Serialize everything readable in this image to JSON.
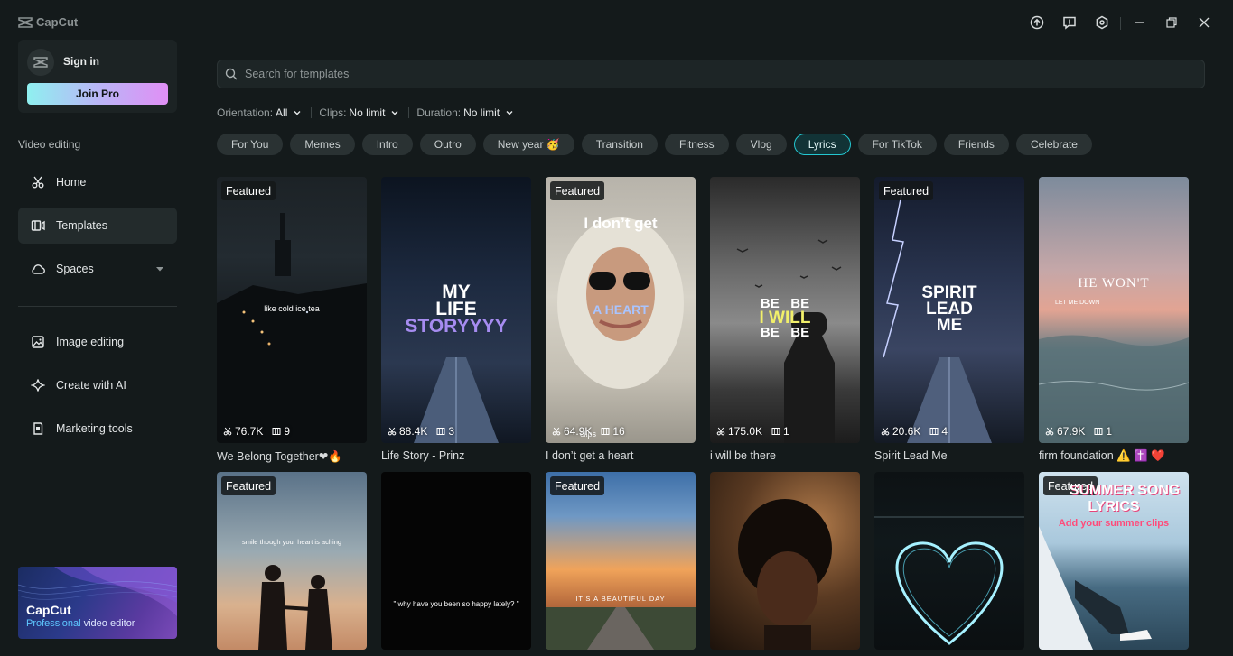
{
  "app": {
    "title": "CapCut"
  },
  "account": {
    "signin_label": "Sign in",
    "joinpro_label": "Join Pro"
  },
  "sidebar": {
    "section_label": "Video editing",
    "items": [
      {
        "label": "Home",
        "icon": "scissors-icon"
      },
      {
        "label": "Templates",
        "icon": "templates-icon",
        "active": true
      },
      {
        "label": "Spaces",
        "icon": "cloud-icon"
      },
      {
        "label": "Image editing",
        "icon": "image-icon"
      },
      {
        "label": "Create with AI",
        "icon": "sparkle-icon"
      },
      {
        "label": "Marketing tools",
        "icon": "marketing-icon"
      }
    ],
    "promo": {
      "title": "CapCut",
      "sub_highlight": "Professional",
      "sub_rest": " video editor"
    }
  },
  "search": {
    "placeholder": "Search for templates",
    "value": ""
  },
  "filters": [
    {
      "label": "Orientation:",
      "value": "All"
    },
    {
      "label": "Clips:",
      "value": "No limit"
    },
    {
      "label": "Duration:",
      "value": "No limit"
    }
  ],
  "chips": [
    "For You",
    "Memes",
    "Intro",
    "Outro",
    "New year 🥳",
    "Transition",
    "Fitness",
    "Vlog",
    "Lyrics",
    "For TikTok",
    "Friends",
    "Celebrate"
  ],
  "active_chip": "Lyrics",
  "featured_label": "Featured",
  "templates": [
    {
      "title": "We Belong Together❤🔥",
      "uses": "76.7K",
      "clips": "9",
      "featured": true,
      "overlay": "like cold ice tea"
    },
    {
      "title": "Life Story - Prinz",
      "uses": "88.4K",
      "clips": "3",
      "featured": false,
      "overlay_l1": "MY",
      "overlay_l2": "LIFE",
      "overlay_l3": "STORYYYY"
    },
    {
      "title": "I don’t get a heart",
      "uses": "64.9K",
      "clips": "16",
      "featured": true,
      "overlay_top": "I don’t get",
      "overlay_mid": "A HEART",
      "overlay_small": "clips"
    },
    {
      "title": "i will be there",
      "uses": "175.0K",
      "clips": "1",
      "featured": false,
      "overlay_be1": "BE",
      "overlay_be2": "BE",
      "overlay_iwill": "I WILL",
      "overlay_be3": "BE",
      "overlay_be4": "BE"
    },
    {
      "title": "Spirit Lead Me",
      "uses": "20.6K",
      "clips": "4",
      "featured": true,
      "overlay_l1": "SPIRIT",
      "overlay_l2": "LEAD",
      "overlay_l3": "ME"
    },
    {
      "title": "firm foundation ⚠️ ✝️ ❤️",
      "uses": "67.9K",
      "clips": "1",
      "featured": false,
      "overlay": "HE WON'T",
      "overlay2": "LET ME DOWN"
    },
    {
      "featured": true,
      "overlay": "smile though your heart is aching"
    },
    {
      "featured": false,
      "overlay": "\" why have you been so happy lately? \""
    },
    {
      "featured": true,
      "overlay": "IT'S A BEAUTIFUL DAY"
    },
    {
      "featured": false
    },
    {
      "featured": false
    },
    {
      "featured": true,
      "overlay_l1": "SUMMER SONG",
      "overlay_l2": "LYRICS",
      "overlay_l3": "Add your summer clips"
    }
  ]
}
